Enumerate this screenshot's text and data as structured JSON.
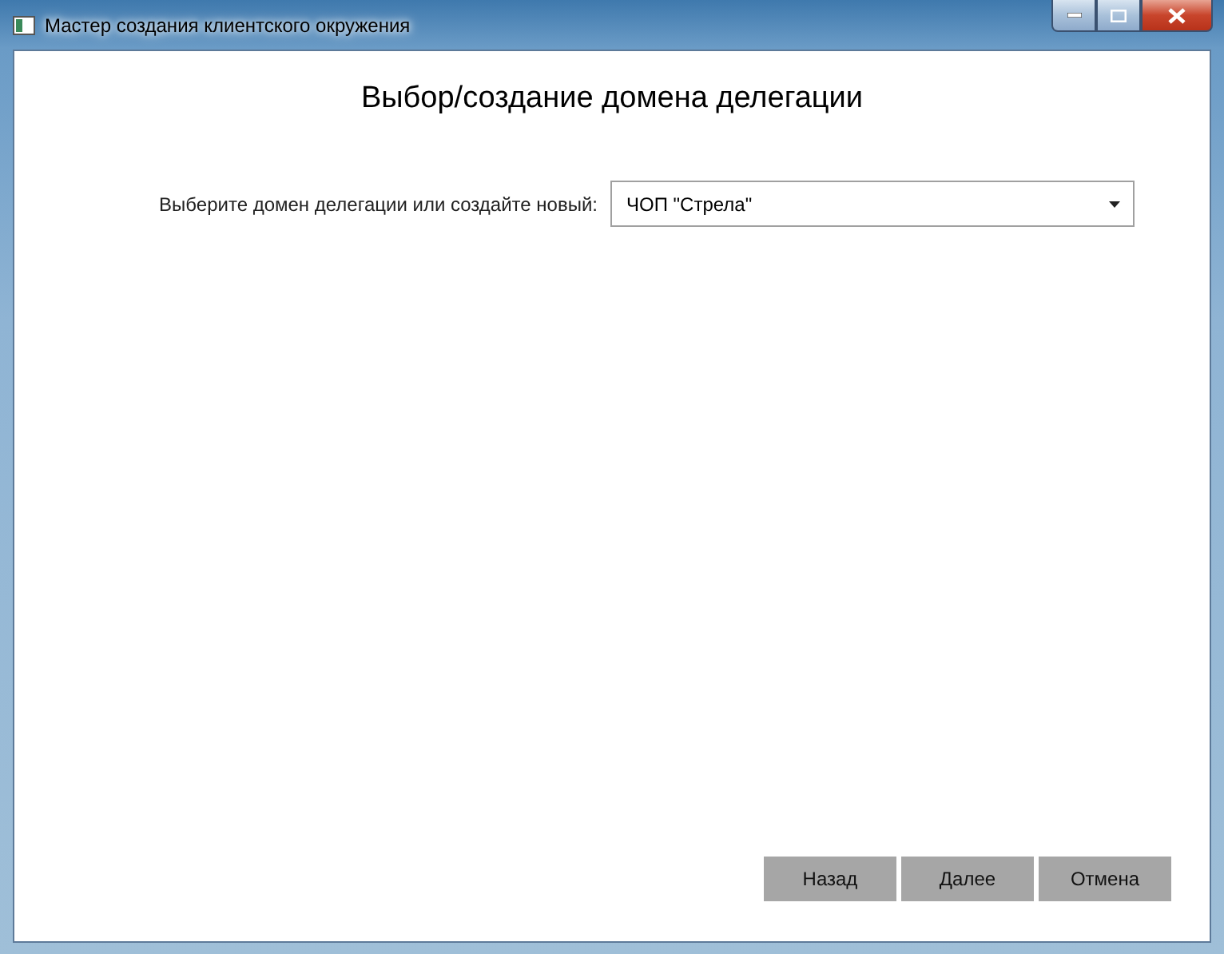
{
  "window": {
    "title": "Мастер создания клиентского окружения"
  },
  "heading": "Выбор/создание домена делегации",
  "domain": {
    "label": "Выберите домен делегации или создайте новый:",
    "value": "ЧОП \"Стрела\""
  },
  "buttons": [
    "Назад",
    "Далее",
    "Отмена"
  ]
}
